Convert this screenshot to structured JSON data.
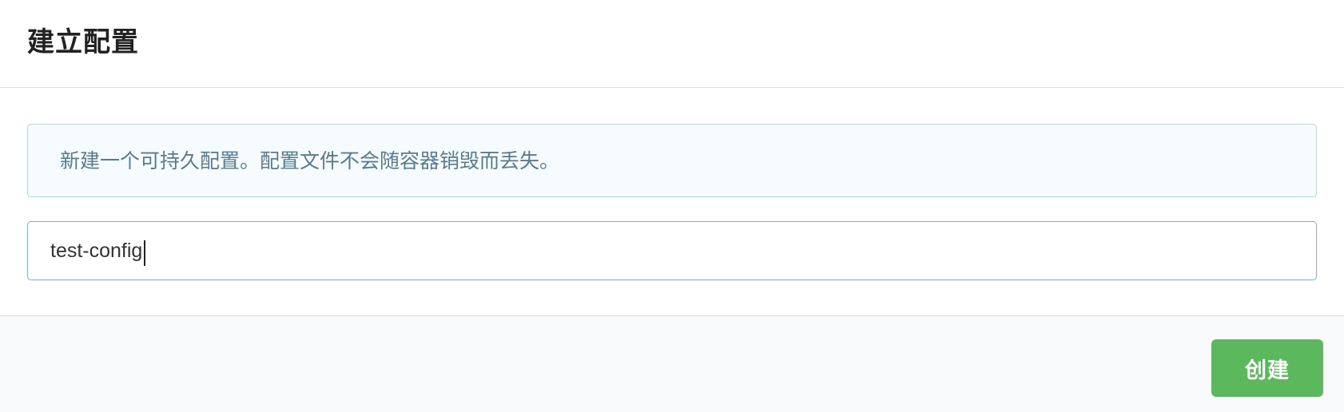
{
  "dialog": {
    "title": "建立配置",
    "info_message": "新建一个可持久配置。配置文件不会随容器销毁而丢失。",
    "config_name_input": {
      "value": "test-config",
      "placeholder": ""
    },
    "create_button_label": "创建"
  },
  "colors": {
    "accent_green": "#5cb85c",
    "info_background": "#f6fcfd",
    "info_border": "#b4d7e3",
    "info_text": "#587b90",
    "input_focus_border": "#89b2cc"
  }
}
